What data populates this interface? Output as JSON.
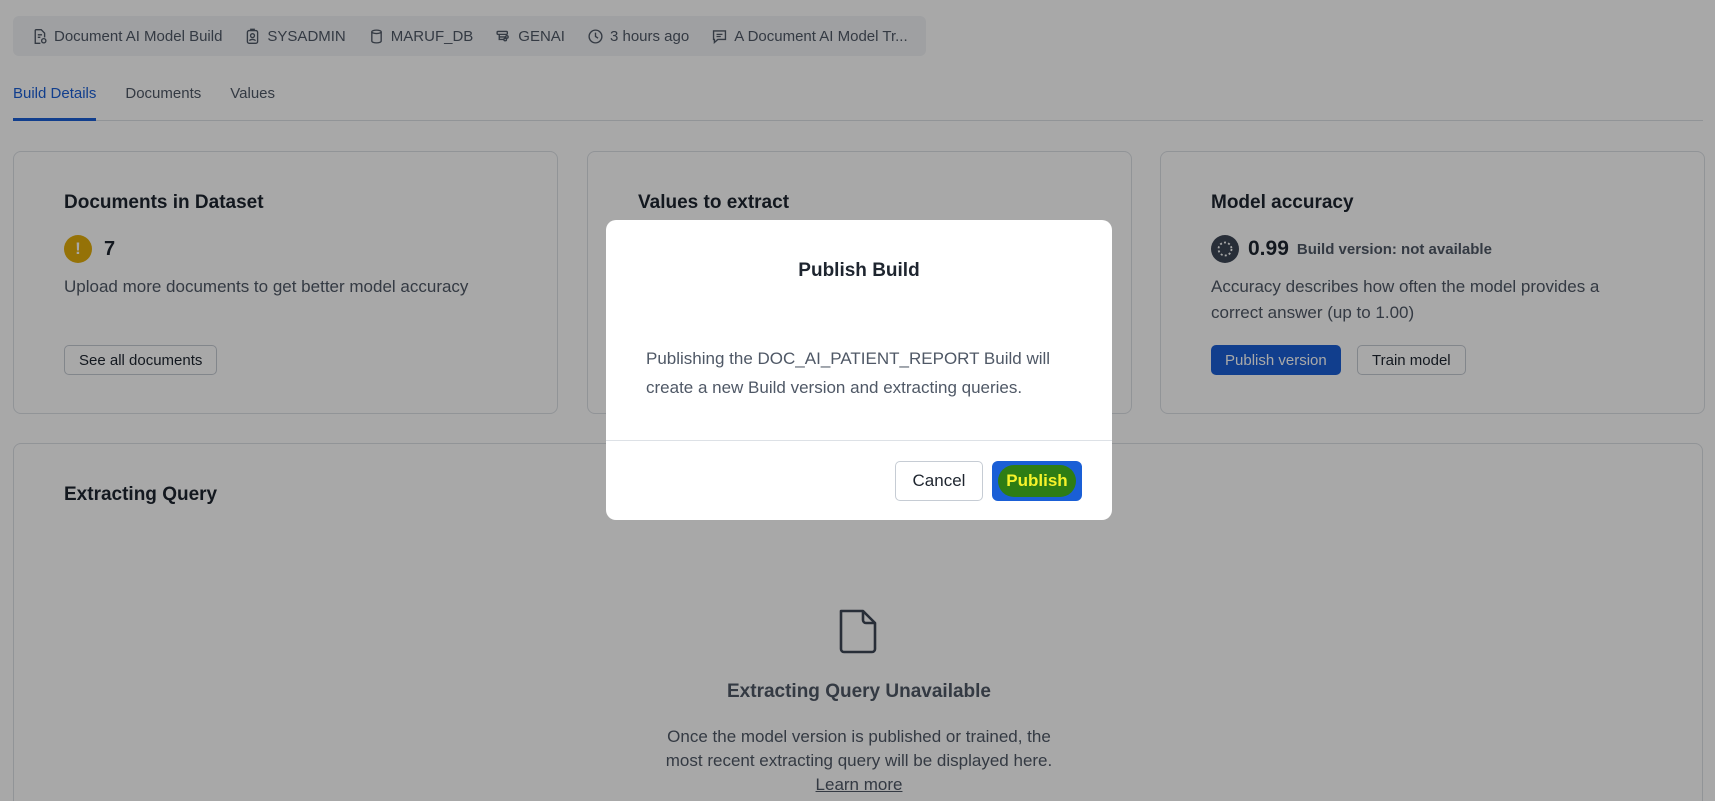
{
  "meta": {
    "items": [
      {
        "icon": "document-build-icon",
        "label": "Document AI Model Build"
      },
      {
        "icon": "user-badge-icon",
        "label": "SYSADMIN"
      },
      {
        "icon": "database-icon",
        "label": "MARUF_DB"
      },
      {
        "icon": "schema-icon",
        "label": "GENAI"
      },
      {
        "icon": "clock-icon",
        "label": "3 hours ago"
      },
      {
        "icon": "comment-icon",
        "label": "A Document AI Model Tr..."
      }
    ]
  },
  "tabs": [
    {
      "label": "Build Details",
      "active": true
    },
    {
      "label": "Documents",
      "active": false
    },
    {
      "label": "Values",
      "active": false
    }
  ],
  "cards": {
    "documents": {
      "title": "Documents in Dataset",
      "count": "7",
      "description": "Upload more documents to get better model accuracy",
      "button": "See all documents"
    },
    "values": {
      "title": "Values to extract"
    },
    "accuracy": {
      "title": "Model accuracy",
      "value": "0.99",
      "version": "Build version: not available",
      "description": "Accuracy describes how often the model provides a correct answer (up to 1.00)",
      "primary_button": "Publish version",
      "secondary_button": "Train model"
    }
  },
  "extracting_query": {
    "title": "Extracting Query",
    "empty_title": "Extracting Query Unavailable",
    "empty_line1": "Once the model version is published or trained, the",
    "empty_line2": "most recent extracting query will be displayed here.",
    "link": "Learn more"
  },
  "modal": {
    "title": "Publish Build",
    "body": "Publishing the DOC_AI_PATIENT_REPORT Build will create a new Build version and extracting queries.",
    "cancel": "Cancel",
    "publish": "Publish"
  },
  "colors": {
    "accent": "#1a5fd6",
    "warning": "#e2ad0b",
    "highlight_bg": "#2e7d14",
    "highlight_text": "#f6f32a"
  }
}
